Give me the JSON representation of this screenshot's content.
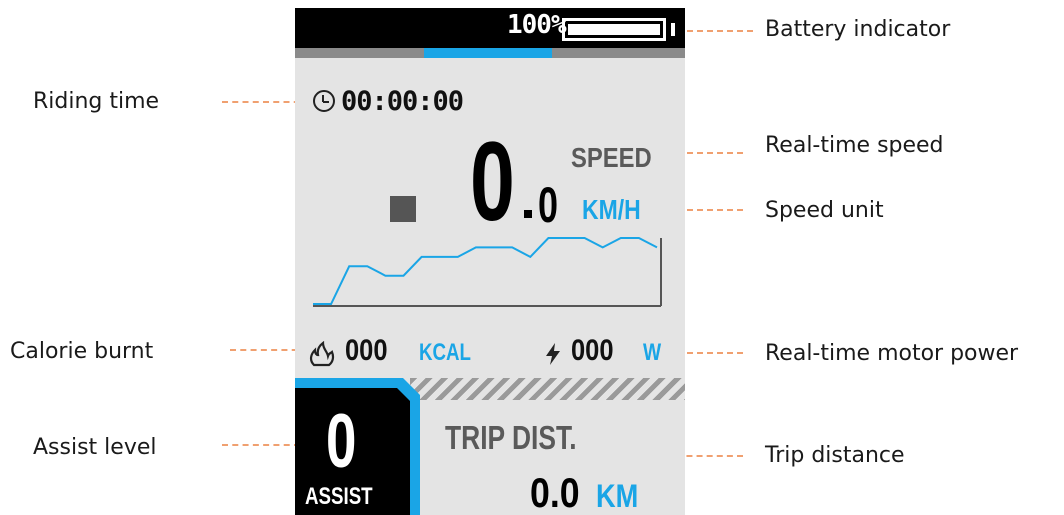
{
  "colors": {
    "accent": "#1aa5e6",
    "screen_bg": "#e4e4e4",
    "leader_line": "#f0a070",
    "top_bar": "#000000"
  },
  "display": {
    "battery": {
      "percent_text": "100%",
      "level": 1.0
    },
    "progress": {
      "segment_start": 0.33,
      "segment_end": 0.66
    },
    "ride_time": "00:00:00",
    "speed": {
      "label": "SPEED",
      "integer": "0",
      "decimal": "0",
      "unit": "KM/H"
    },
    "calorie": {
      "value": "000",
      "unit": "KCAL",
      "icon": "flame-icon"
    },
    "power": {
      "value": "000",
      "unit": "W",
      "icon": "bolt-icon"
    },
    "assist": {
      "level": "0",
      "label": "ASSIST"
    },
    "trip": {
      "label": "TRIP DIST.",
      "value": "0.0",
      "unit": "KM"
    },
    "clock_icon": "clock-icon",
    "speed_history": [
      0,
      0,
      4,
      4,
      3,
      3,
      5,
      5,
      5,
      6,
      6,
      6,
      5,
      7,
      7,
      7,
      6,
      7,
      7,
      6
    ]
  },
  "callouts": {
    "battery_indicator": "Battery indicator",
    "riding_time": "Riding  time",
    "realtime_speed": "Real-time speed",
    "speed_unit": "Speed unit",
    "calorie_burnt": "Calorie burnt",
    "motor_power": "Real-time motor power",
    "assist_level": "Assist  level",
    "trip_distance": "Trip distance"
  }
}
